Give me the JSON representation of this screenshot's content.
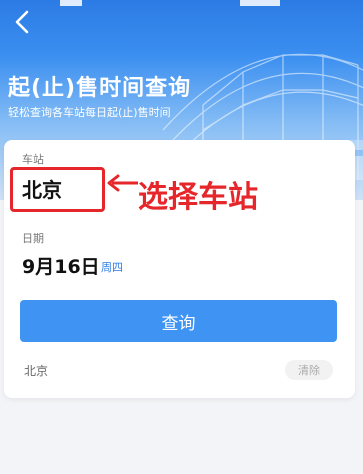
{
  "header": {
    "title": "起(止)售时间查询",
    "subtitle": "轻松查询各车站每日起(止)售时间"
  },
  "form": {
    "station_label": "车站",
    "station_value": "北京",
    "date_label": "日期",
    "date_value": "9月16日",
    "weekday": "周四",
    "query_label": "查询"
  },
  "annotation": {
    "text": "选择车站",
    "color": "#e5262a"
  },
  "history": {
    "items": [
      "北京"
    ],
    "clear_label": "清除"
  },
  "colors": {
    "accent": "#3f93f2",
    "header_top": "#2c7be5"
  }
}
